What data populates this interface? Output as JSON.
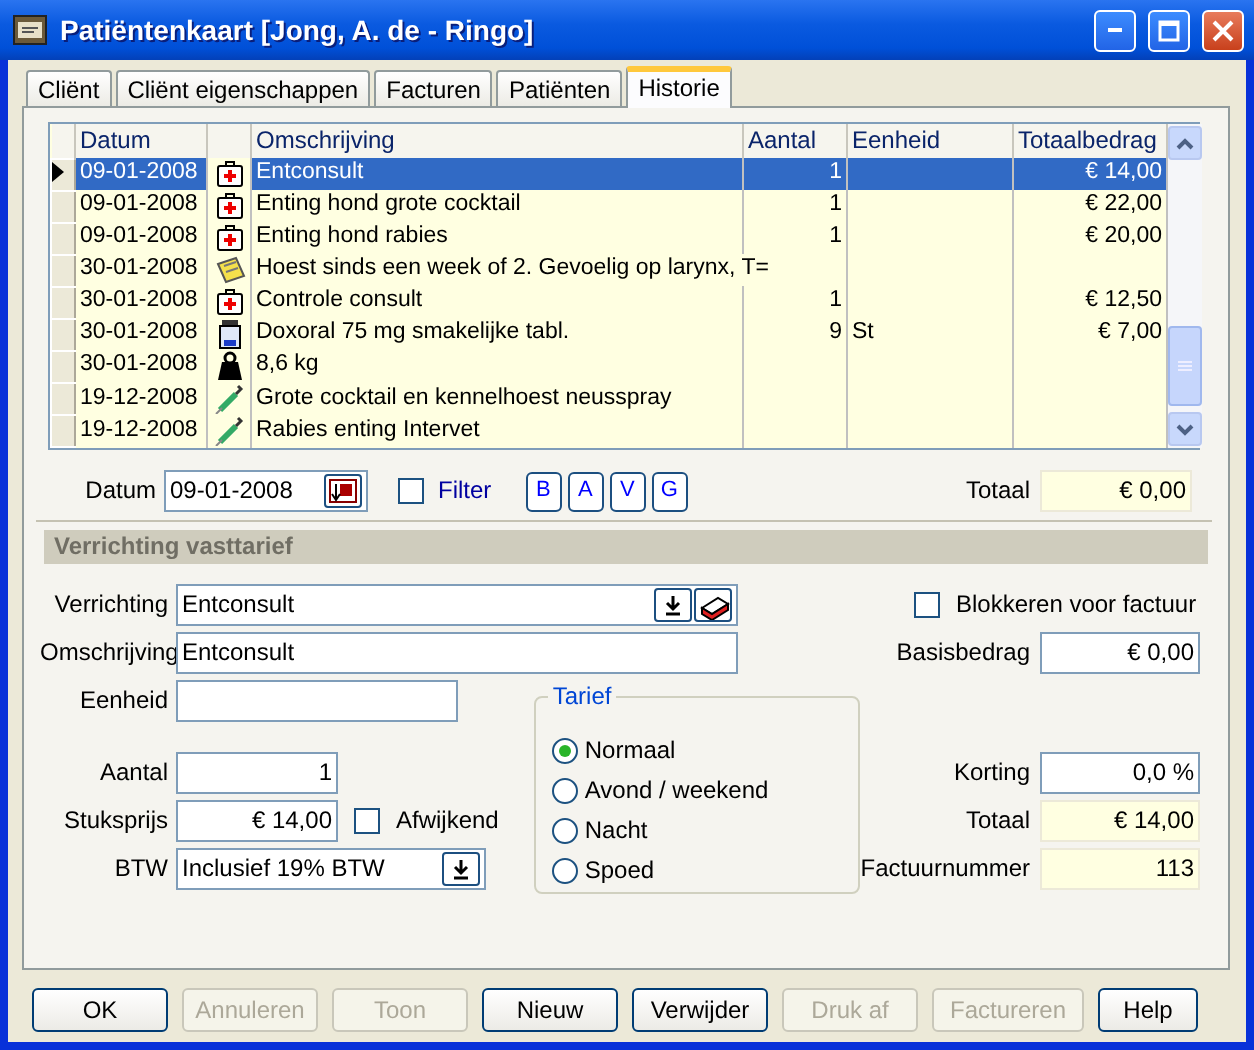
{
  "window": {
    "title": "Patiëntenkaart [Jong, A. de - Ringo]"
  },
  "tabs": [
    {
      "label": "Cliënt",
      "selected": false
    },
    {
      "label": "Cliënt eigenschappen",
      "selected": false
    },
    {
      "label": "Facturen",
      "selected": false
    },
    {
      "label": "Patiënten",
      "selected": false
    },
    {
      "label": "Historie",
      "selected": true
    }
  ],
  "history": {
    "columns": [
      "Datum",
      "Omschrijving",
      "Aantal",
      "Eenheid",
      "Totaalbedrag"
    ],
    "rows": [
      {
        "date": "09-01-2008",
        "kind": "medkit",
        "description": "Entconsult",
        "amount": "1",
        "unit": "",
        "total": "€ 14,00",
        "selected": true
      },
      {
        "date": "09-01-2008",
        "kind": "medkit",
        "description": "Enting hond grote cocktail",
        "amount": "1",
        "unit": "",
        "total": "€ 22,00",
        "selected": false
      },
      {
        "date": "09-01-2008",
        "kind": "medkit",
        "description": "Enting hond rabies",
        "amount": "1",
        "unit": "",
        "total": "€ 20,00",
        "selected": false
      },
      {
        "date": "30-01-2008",
        "kind": "note",
        "description": "Hoest sinds een week of 2. Gevoelig op larynx, T=",
        "amount": "",
        "unit": "",
        "total": "",
        "selected": false
      },
      {
        "date": "30-01-2008",
        "kind": "medkit",
        "description": "Controle consult",
        "amount": "1",
        "unit": "",
        "total": "€ 12,50",
        "selected": false
      },
      {
        "date": "30-01-2008",
        "kind": "bottle",
        "description": "Doxoral 75 mg smakelijke tabl.",
        "amount": "9",
        "unit": "St",
        "total": "€ 7,00",
        "selected": false
      },
      {
        "date": "30-01-2008",
        "kind": "weight",
        "description": "8,6 kg",
        "amount": "",
        "unit": "",
        "total": "",
        "selected": false
      },
      {
        "date": "19-12-2008",
        "kind": "syringe",
        "description": "Grote cocktail en kennelhoest neusspray",
        "amount": "",
        "unit": "",
        "total": "",
        "selected": false
      },
      {
        "date": "19-12-2008",
        "kind": "syringe",
        "description": "Rabies enting Intervet",
        "amount": "",
        "unit": "",
        "total": "",
        "selected": false
      }
    ]
  },
  "filter": {
    "date_label": "Datum",
    "date": "09-01-2008",
    "filter_label": "Filter",
    "filter_checked": false,
    "letters": [
      "B",
      "A",
      "V",
      "G"
    ],
    "total_label": "Totaal",
    "total": "€ 0,00"
  },
  "section": {
    "title": "Verrichting vasttarief"
  },
  "form": {
    "verrichting_label": "Verrichting",
    "verrichting": "Entconsult",
    "omschrijving_label": "Omschrijving",
    "omschrijving": "Entconsult",
    "eenheid_label": "Eenheid",
    "aantal_label": "Aantal",
    "aantal": "1",
    "stuksprijs_label": "Stuksprijs",
    "stuksprijs": "€ 14,00",
    "afwijkend_label": "Afwijkend",
    "afwijkend_checked": false,
    "btw_label": "BTW",
    "btw": "Inclusief 19% BTW",
    "blokkeren_label": "Blokkeren voor factuur",
    "blokkeren_checked": false,
    "basisbedrag_label": "Basisbedrag",
    "basisbedrag": "€ 0,00",
    "korting_label": "Korting",
    "korting": "0,0 %",
    "totaal_label": "Totaal",
    "totaal": "€ 14,00",
    "factuurnummer_label": "Factuurnummer",
    "factuurnummer": "113"
  },
  "tarief": {
    "title": "Tarief",
    "options": [
      {
        "label": "Normaal",
        "selected": true
      },
      {
        "label": "Avond / weekend",
        "selected": false
      },
      {
        "label": "Nacht",
        "selected": false
      },
      {
        "label": "Spoed",
        "selected": false
      }
    ]
  },
  "buttons": [
    {
      "label": "OK",
      "disabled": false
    },
    {
      "label": "Annuleren",
      "disabled": true
    },
    {
      "label": "Toon",
      "disabled": true
    },
    {
      "label": "Nieuw",
      "disabled": false
    },
    {
      "label": "Verwijder",
      "disabled": false
    },
    {
      "label": "Druk af",
      "disabled": true
    },
    {
      "label": "Factureren",
      "disabled": true
    },
    {
      "label": "Help",
      "disabled": false
    }
  ]
}
